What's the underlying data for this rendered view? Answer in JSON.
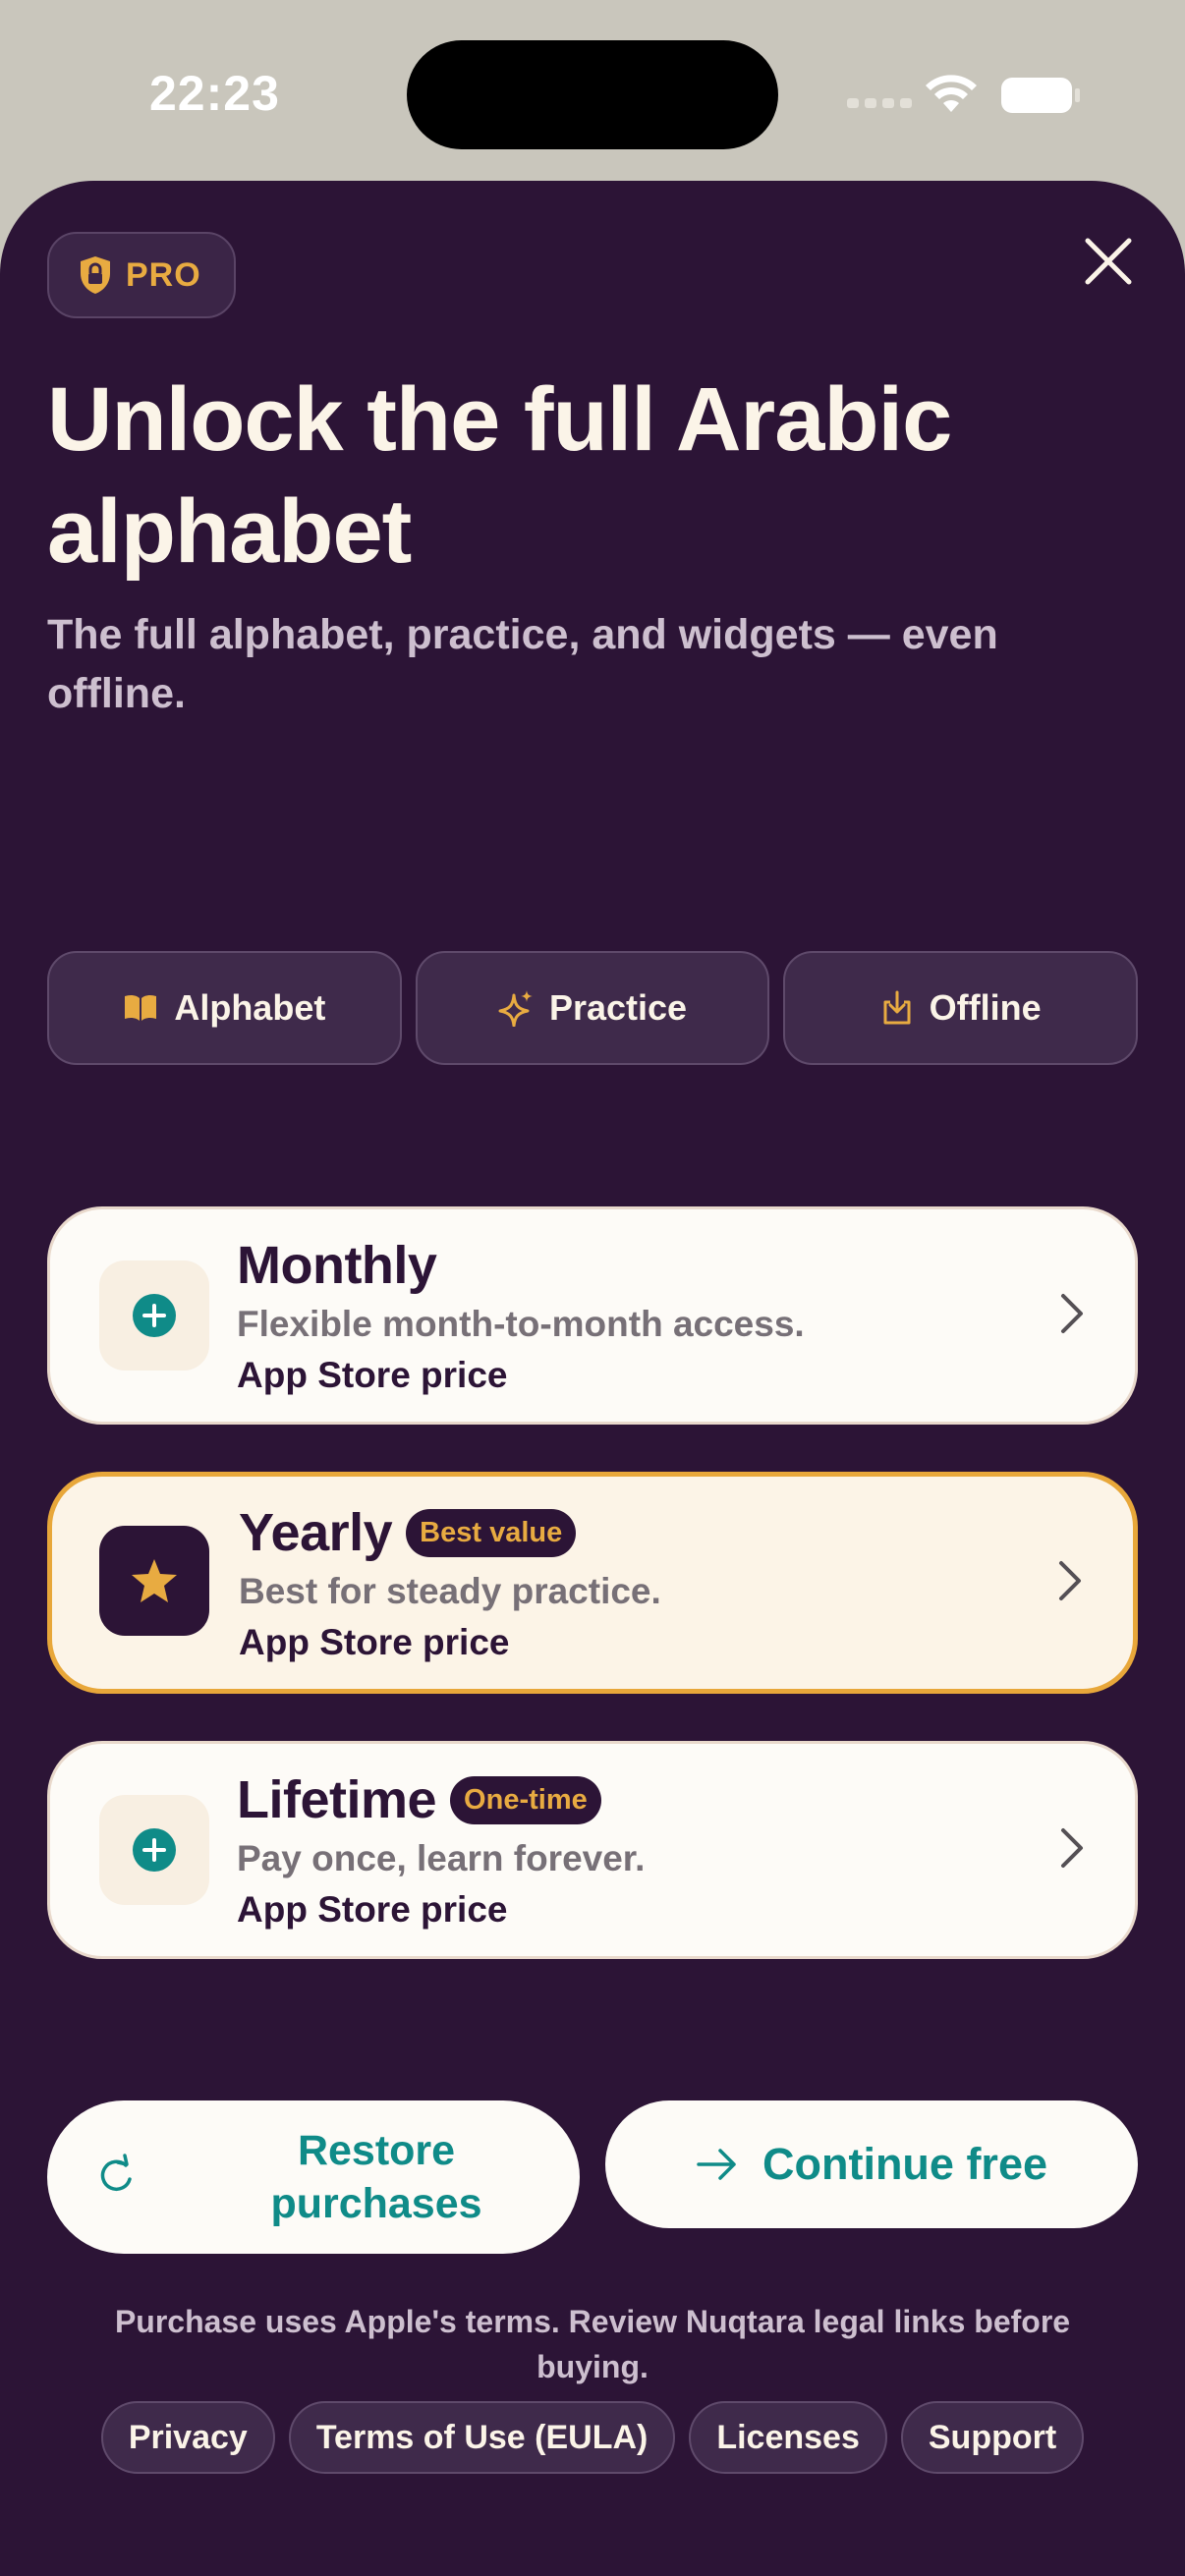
{
  "status_bar": {
    "time": "22:23"
  },
  "badge": {
    "label": "PRO",
    "icon": "lock-icon"
  },
  "header": {
    "title": "Unlock the full Arabic alphabet",
    "subtitle": "The full alphabet, practice, and widgets — even offline."
  },
  "features": [
    {
      "label": "Alphabet",
      "icon": "book-icon"
    },
    {
      "label": "Practice",
      "icon": "sparkle-icon"
    },
    {
      "label": "Offline",
      "icon": "download-icon"
    }
  ],
  "plans": [
    {
      "name": "Monthly",
      "tag": "",
      "description": "Flexible month-to-month access.",
      "price": "App Store price",
      "icon": "plus-circle-icon",
      "selected": false
    },
    {
      "name": "Yearly",
      "tag": "Best value",
      "description": "Best for steady practice.",
      "price": "App Store price",
      "icon": "star-icon",
      "selected": true
    },
    {
      "name": "Lifetime",
      "tag": "One-time",
      "description": "Pay once, learn forever.",
      "price": "App Store price",
      "icon": "plus-circle-icon",
      "selected": false
    }
  ],
  "actions": {
    "restore": "Restore purchases",
    "continue": "Continue free"
  },
  "legal": {
    "text": "Purchase uses Apple's terms. Review Nuqtara legal links before buying.",
    "links": [
      "Privacy",
      "Terms of Use (EULA)",
      "Licenses",
      "Support"
    ]
  },
  "colors": {
    "background": "#2c1436",
    "accent": "#e8ab41",
    "teal": "#0f8b88",
    "cream": "#fdfbf7"
  }
}
